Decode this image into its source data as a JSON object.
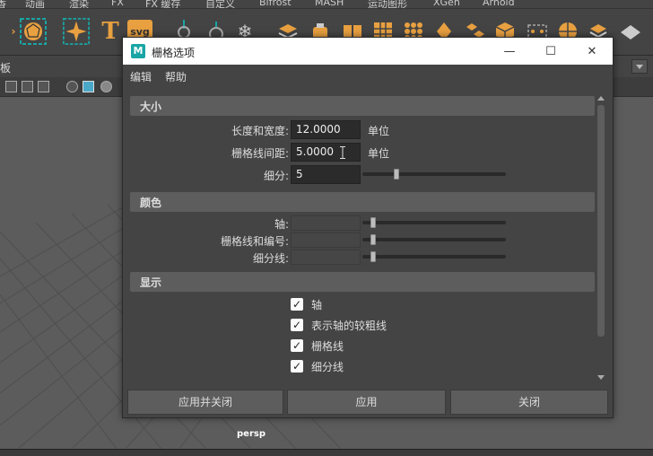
{
  "maya": {
    "shelf_tabs": [
      "香",
      "动画",
      "渲染",
      "FX",
      "FX 缓存",
      "自定义",
      "Bifrost",
      "MASH",
      "运动图形",
      "XGen",
      "Arnold"
    ],
    "panel_label": "板",
    "viewport_label": "persp",
    "shelf_text_icons": {
      "t": "T",
      "svg": "svg"
    }
  },
  "dialog": {
    "title": "栅格选项",
    "app_icon_letter": "M",
    "window_buttons": {
      "minimize": "—",
      "maximize": "☐",
      "close": "✕"
    },
    "menu": [
      "编辑",
      "帮助"
    ],
    "sections": {
      "size": {
        "header": "大小",
        "length_width_label": "长度和宽度:",
        "length_width_value": "12.0000",
        "length_width_unit": "单位",
        "grid_spacing_label": "栅格线间距:",
        "grid_spacing_value": "5.0000",
        "grid_spacing_unit": "单位",
        "subdivisions_label": "细分:",
        "subdivisions_value": "5"
      },
      "color": {
        "header": "颜色",
        "axes_label": "轴:",
        "gridlines_label": "栅格线和编号:",
        "subdivision_lines_label": "细分线:"
      },
      "display": {
        "header": "显示",
        "checkboxes": [
          {
            "label": "轴",
            "checked": true
          },
          {
            "label": "表示轴的较粗线",
            "checked": true
          },
          {
            "label": "栅格线",
            "checked": true
          },
          {
            "label": "细分线",
            "checked": true
          }
        ]
      }
    },
    "buttons": {
      "apply_close": "应用并关闭",
      "apply": "应用",
      "close": "关闭"
    },
    "colors": {
      "accent": "#1aa5a5",
      "section_header": "#5d5d5d",
      "field_bg": "#2b2b2b"
    }
  }
}
